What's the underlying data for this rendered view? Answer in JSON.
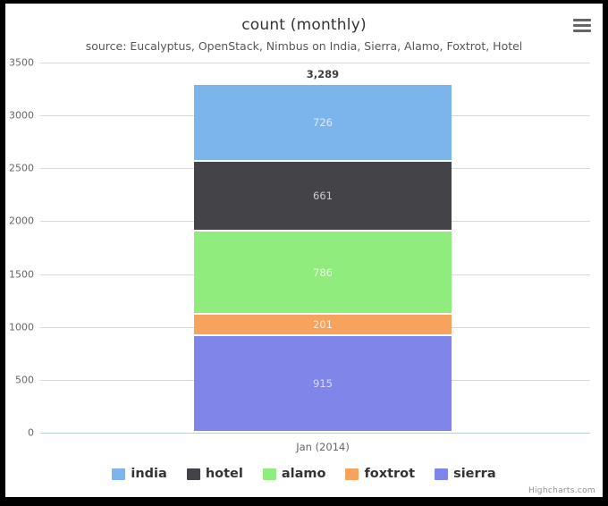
{
  "chart_data": {
    "type": "bar",
    "title": "count (monthly)",
    "subtitle": "source: Eucalyptus, OpenStack, Nimbus on India, Sierra, Alamo, Foxtrot, Hotel",
    "stacked": true,
    "xlabel": "",
    "ylabel": "",
    "categories": [
      "Jan (2014)"
    ],
    "ylim": [
      0,
      3500
    ],
    "ytick_step": 500,
    "ytick_labels": [
      "3500",
      "3000",
      "2500",
      "2000",
      "1500",
      "1000",
      "500",
      "0"
    ],
    "grid": true,
    "legend_position": "bottom",
    "stack_totals": [
      "3,289"
    ],
    "series": [
      {
        "name": "india",
        "values": [
          726
        ],
        "label": "726",
        "color": "#7cb5ec"
      },
      {
        "name": "hotel",
        "values": [
          661
        ],
        "label": "661",
        "color": "#434348"
      },
      {
        "name": "alamo",
        "values": [
          786
        ],
        "label": "786",
        "color": "#90ed7d"
      },
      {
        "name": "foxtrot",
        "values": [
          201
        ],
        "label": "201",
        "color": "#f7a35c"
      },
      {
        "name": "sierra",
        "values": [
          915
        ],
        "label": "915",
        "color": "#8085e9"
      }
    ]
  },
  "header": {
    "title": "count (monthly)",
    "subtitle": "source: Eucalyptus, OpenStack, Nimbus on India, Sierra, Alamo, Foxtrot, Hotel",
    "context_menu_icon": "hamburger-icon"
  },
  "yaxis": {
    "ticks": [
      "3500",
      "3000",
      "2500",
      "2000",
      "1500",
      "1000",
      "500",
      "0"
    ]
  },
  "xaxis": {
    "categories": [
      "Jan (2014)"
    ]
  },
  "stack": {
    "total": "3,289",
    "segments": [
      {
        "name": "india",
        "label": "726",
        "color": "#7cb5ec"
      },
      {
        "name": "hotel",
        "label": "661",
        "color": "#434348"
      },
      {
        "name": "alamo",
        "label": "786",
        "color": "#90ed7d"
      },
      {
        "name": "foxtrot",
        "label": "201",
        "color": "#f7a35c"
      },
      {
        "name": "sierra",
        "label": "915",
        "color": "#8085e9"
      }
    ]
  },
  "legend": {
    "items": [
      {
        "label": "india",
        "color": "#7cb5ec"
      },
      {
        "label": "hotel",
        "color": "#434348"
      },
      {
        "label": "alamo",
        "color": "#90ed7d"
      },
      {
        "label": "foxtrot",
        "color": "#f7a35c"
      },
      {
        "label": "sierra",
        "color": "#8085e9"
      }
    ]
  },
  "credits": {
    "text": "Highcharts.com"
  }
}
